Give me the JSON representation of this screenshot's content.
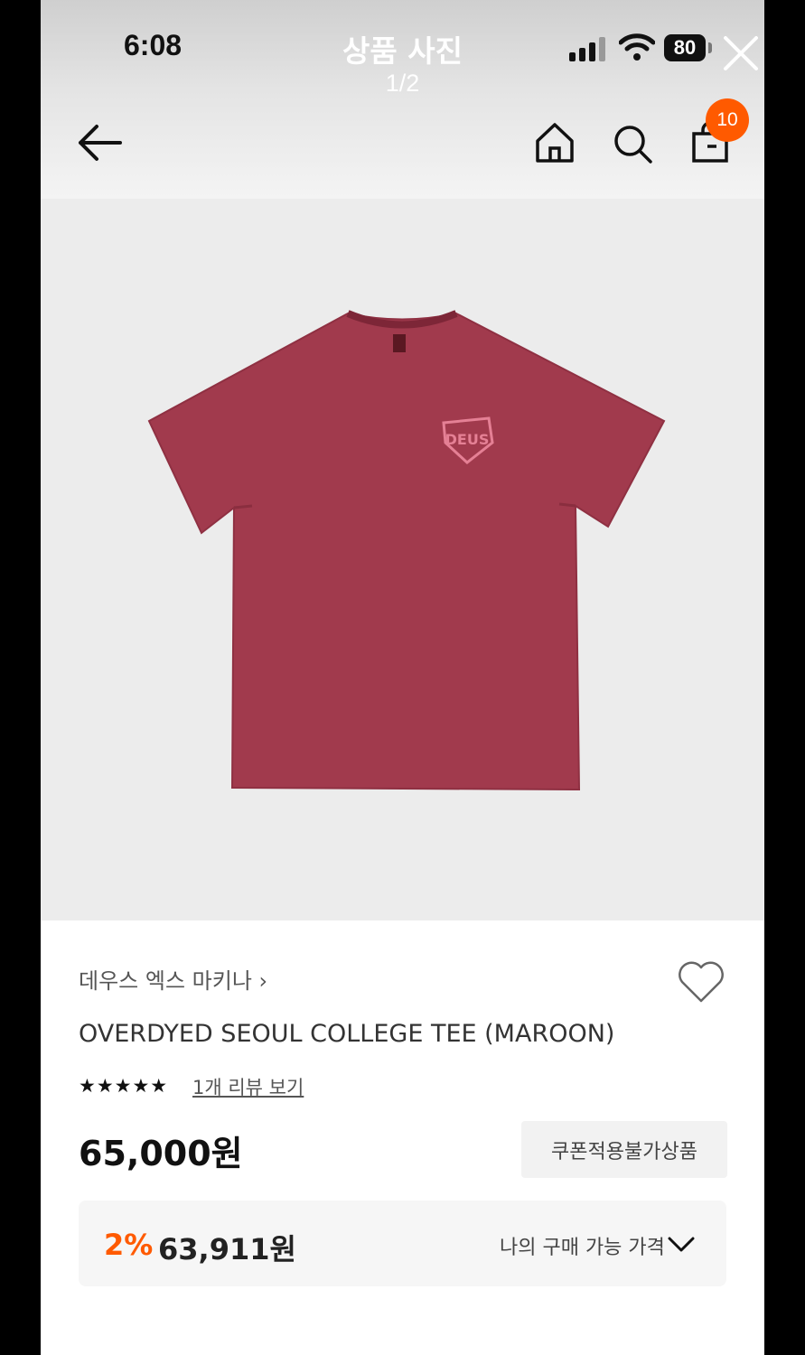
{
  "status_bar": {
    "time": "6:08",
    "battery": "80"
  },
  "viewer": {
    "title": "상품 사진",
    "counter": "1/2"
  },
  "header": {
    "cart_count": "10"
  },
  "product": {
    "brand": "데우스 엑스 마키나",
    "name": "OVERDYED SEOUL COLLEGE TEE (MAROON)",
    "rating_stars": "★★★★★",
    "review_link": "1개 리뷰 보기",
    "price": "65,000원",
    "coupon_note": "쿠폰적용불가상품",
    "discount_rate": "2%",
    "discount_price": "63,911원",
    "my_price_label": "나의 구매 가능 가격",
    "shirt_logo": "DEUS"
  },
  "colors": {
    "accent": "#ff5a00",
    "shirt": "#a13a4d"
  }
}
